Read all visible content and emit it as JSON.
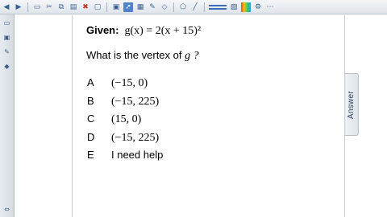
{
  "toolbar": {
    "icons": [
      "back-arrow-icon",
      "forward-arrow-icon",
      "new-page-icon",
      "cut-icon",
      "copy-icon",
      "paste-icon",
      "delete-icon",
      "add-page-icon",
      "screen-capture-icon",
      "select-icon",
      "text-tool-icon",
      "pen-icon",
      "eraser-icon",
      "shape-icon",
      "line-width-icon",
      "color-palette-icon"
    ]
  },
  "sidebar": {
    "icons": [
      "page-sorter-icon",
      "gallery-icon",
      "attachments-icon",
      "properties-icon"
    ]
  },
  "content": {
    "given_label": "Given:",
    "given_formula": "g(x) = 2(x + 15)²",
    "question_prefix": "What is the vertex of ",
    "question_fn": "g ?",
    "options": [
      {
        "letter": "A",
        "value": "(−15, 0)"
      },
      {
        "letter": "B",
        "value": "(−15, 225)"
      },
      {
        "letter": "C",
        "value": "(15, 0)"
      },
      {
        "letter": "D",
        "value": "(−15, 225)"
      },
      {
        "letter": "E",
        "value": "I need help"
      }
    ]
  },
  "answer_tab": {
    "label": "Answer"
  },
  "colors": {
    "toolbar_icon": "#3a5f8f",
    "accent": "#4f83c9",
    "border": "#b9c2cc"
  }
}
